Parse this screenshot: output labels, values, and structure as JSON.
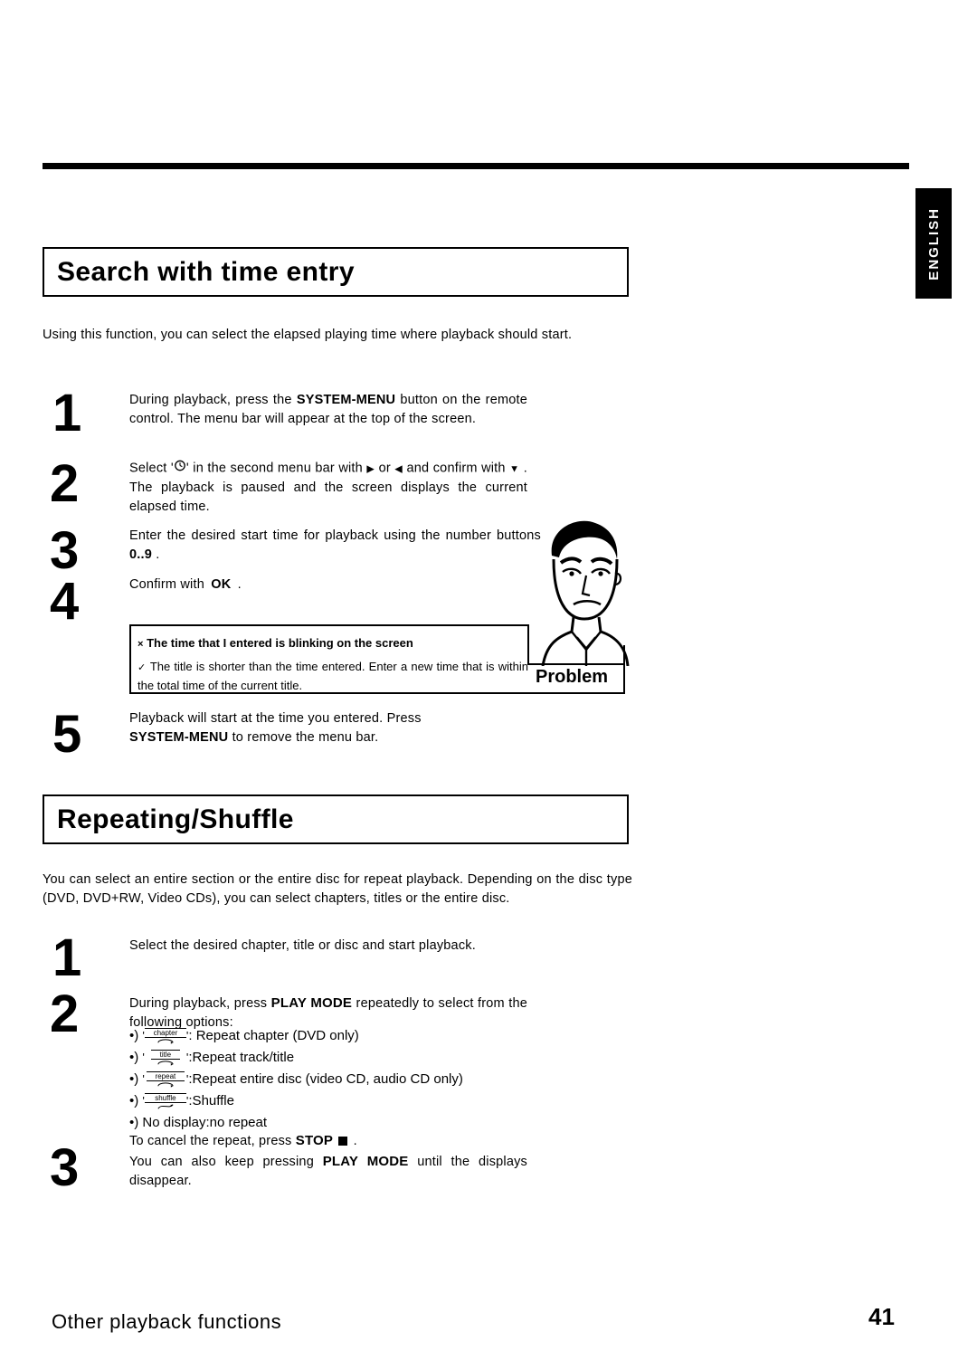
{
  "sidebar": {
    "language_tab": "ENGLISH"
  },
  "sections": [
    {
      "title": "Search with time entry",
      "intro": "Using this function, you can select the elapsed playing time where playback should start.",
      "steps": [
        {
          "num": "1",
          "text_pre": "During playback, press the",
          "bold": "SYSTEM-MENU",
          "text_post": "button on the remote control. The menu bar will appear at the top of the screen."
        },
        {
          "num": "2",
          "text": "Select ' ⏱ ' in the second menu bar with ▶ or ◀ and confirm with ▼ . The playback is paused and the screen displays the current elapsed time."
        },
        {
          "num": "3",
          "text_pre": "Enter the desired start time for playback using the number buttons",
          "bold": "0..9",
          "text_post": "."
        },
        {
          "num": "4",
          "text_pre": "Confirm with",
          "bold": "OK",
          "text_post": "."
        },
        {
          "num": "5",
          "text_pre": "Playback will start at the time you entered. Press",
          "bold": "SYSTEM-MENU",
          "text_post": "to remove the menu bar."
        }
      ],
      "problem": {
        "label": "Problem",
        "title": "The time that I entered is blinking on the screen",
        "body": "The title is shorter than the time entered. Enter a new time that is within the total time of the current title.",
        "bullet_title": "×",
        "bullet_body": "✓"
      }
    },
    {
      "title": "Repeating/Shuffle",
      "intro": "You can select an entire section or the entire disc for repeat playback. Depending on the disc type (DVD, DVD+RW, Video CDs), you can select chapters, titles or the entire disc.",
      "steps": [
        {
          "num": "1",
          "text": "Select the desired chapter, title or disc and start playback."
        },
        {
          "num": "2",
          "text_pre": "During playback, press",
          "bold": "PLAY MODE",
          "text_post": "repeatedly to select from the following options:"
        },
        {
          "num": "3",
          "line1_pre": "To cancel the repeat, press",
          "line1_bold": "STOP",
          "line1_post": ".",
          "line2_pre": "You can also keep pressing",
          "line2_bold": "PLAY MODE",
          "line2_post": "until the displays disappear."
        }
      ],
      "options": [
        {
          "icon": "chapter",
          "label": ": Repeat chapter (DVD only)"
        },
        {
          "icon": "title",
          "label": ":Repeat track/title"
        },
        {
          "icon": "repeat",
          "label": ":Repeat entire disc (video CD, audio CD only)"
        },
        {
          "icon": "shuffle",
          "label": ":Shuffle"
        },
        {
          "icon": "",
          "label": "No display:no repeat"
        }
      ]
    }
  ],
  "footer": {
    "chapter": "Other playback functions",
    "page": "41"
  }
}
